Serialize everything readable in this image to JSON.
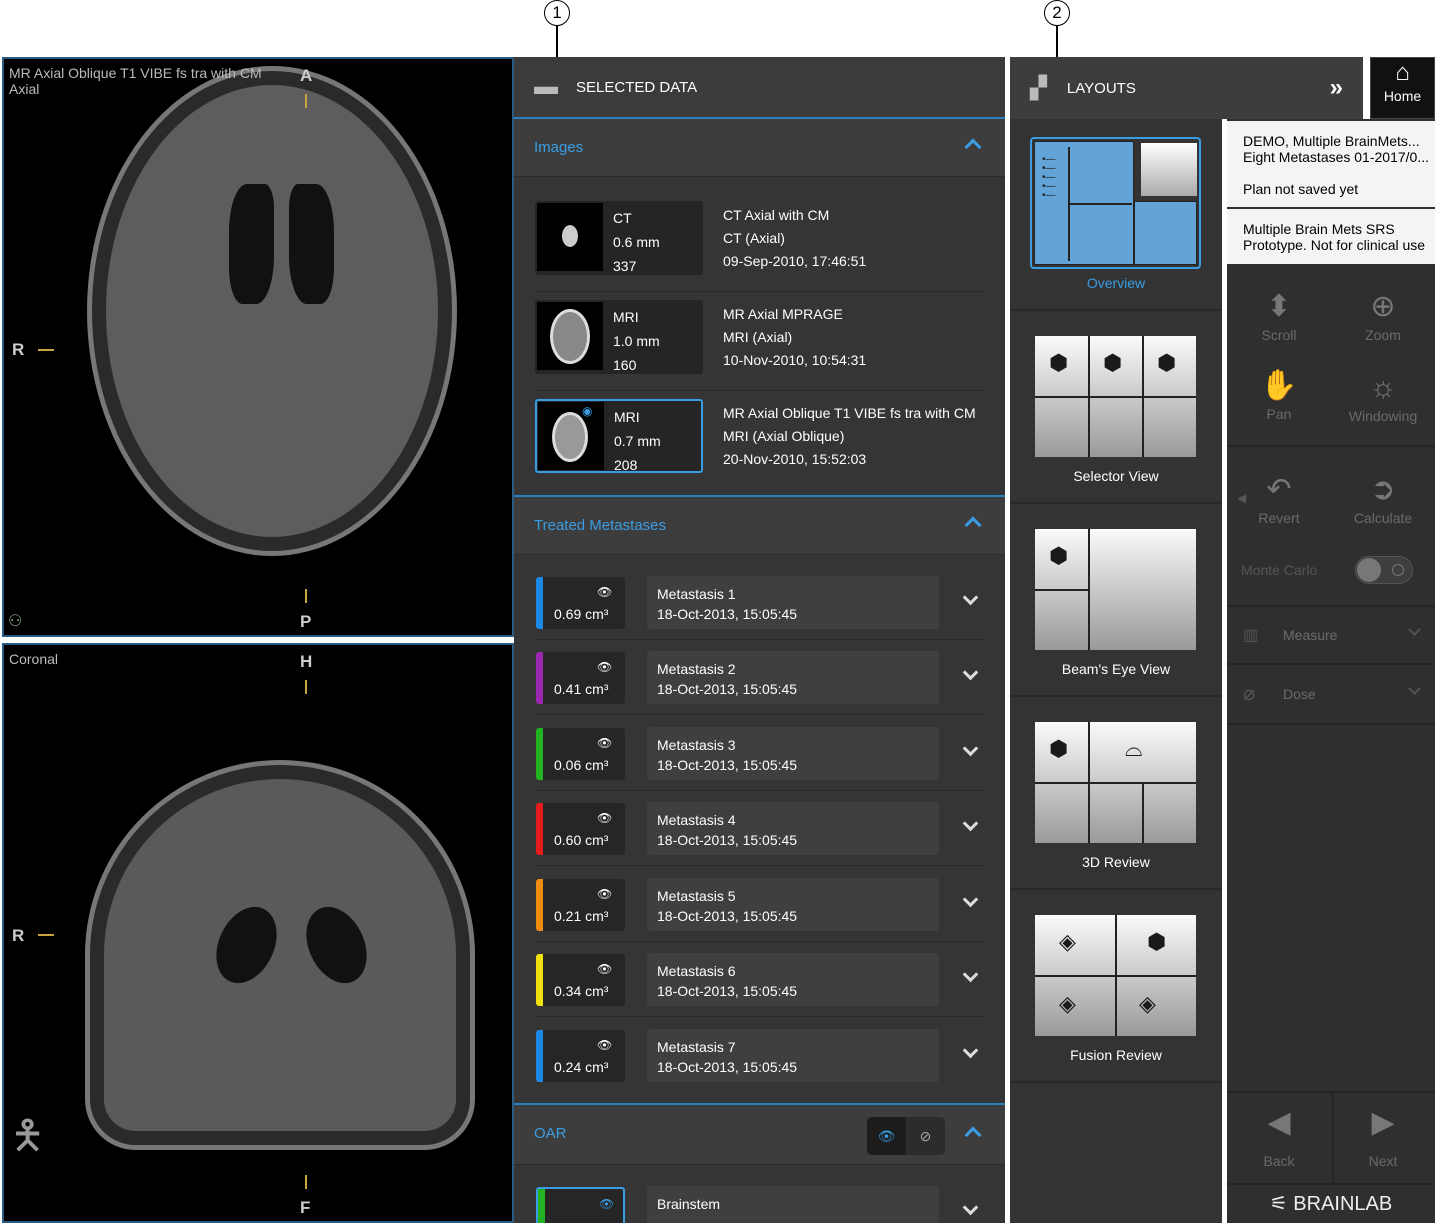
{
  "callouts": [
    "1",
    "2"
  ],
  "viewer_axial": {
    "title": "MR Axial Oblique T1 VIBE fs tra with CM\nAxial",
    "top": "A",
    "bottom": "P",
    "left": "R"
  },
  "viewer_coronal": {
    "title": "Coronal",
    "top": "H",
    "bottom": "F",
    "left": "R"
  },
  "selected_data": {
    "title": "SELECTED DATA",
    "images_title": "Images",
    "images": [
      {
        "modality": "CT",
        "thickness": "0.6 mm",
        "slices": "337",
        "name": "CT Axial with CM",
        "type": "CT (Axial)",
        "date": "09-Sep-2010, 17:46:51"
      },
      {
        "modality": "MRI",
        "thickness": "1.0 mm",
        "slices": "160",
        "name": "MR Axial MPRAGE",
        "type": "MRI (Axial)",
        "date": "10-Nov-2010, 10:54:31"
      },
      {
        "modality": "MRI",
        "thickness": "0.7 mm",
        "slices": "208",
        "name": "MR Axial Oblique T1 VIBE fs tra with CM",
        "type": "MRI (Axial Oblique)",
        "date": "20-Nov-2010, 15:52:03"
      }
    ],
    "metastases_title": "Treated Metastases",
    "metastases": [
      {
        "volume": "0.69 cm³",
        "name": "Metastasis 1",
        "date": "18-Oct-2013, 15:05:45",
        "color": "#1e88e5"
      },
      {
        "volume": "0.41 cm³",
        "name": "Metastasis 2",
        "date": "18-Oct-2013, 15:05:45",
        "color": "#9c27b0"
      },
      {
        "volume": "0.06 cm³",
        "name": "Metastasis 3",
        "date": "18-Oct-2013, 15:05:45",
        "color": "#22b222"
      },
      {
        "volume": "0.60 cm³",
        "name": "Metastasis 4",
        "date": "18-Oct-2013, 15:05:45",
        "color": "#e51c1c"
      },
      {
        "volume": "0.21 cm³",
        "name": "Metastasis 5",
        "date": "18-Oct-2013, 15:05:45",
        "color": "#f08c10"
      },
      {
        "volume": "0.34 cm³",
        "name": "Metastasis 6",
        "date": "18-Oct-2013, 15:05:45",
        "color": "#f0e010"
      },
      {
        "volume": "0.24 cm³",
        "name": "Metastasis 7",
        "date": "18-Oct-2013, 15:05:45",
        "color": "#1e88e5"
      }
    ],
    "oar_title": "OAR",
    "oar": [
      {
        "name": "Brainstem",
        "color": "#22b222"
      }
    ]
  },
  "layouts": {
    "title": "LAYOUTS",
    "items": [
      "Overview",
      "Selector View",
      "Beam's Eye View",
      "3D Review",
      "Fusion Review"
    ]
  },
  "home_label": "Home",
  "info": {
    "patient_line1": "DEMO, Multiple BrainMets...",
    "patient_line2": "Eight Metastases 01-2017/0...",
    "plan_status": "Plan not saved yet",
    "notice_line1": "Multiple Brain Mets SRS",
    "notice_line2": "Prototype. Not for clinical use"
  },
  "tools": {
    "scroll": "Scroll",
    "zoom": "Zoom",
    "pan": "Pan",
    "windowing": "Windowing",
    "revert": "Revert",
    "calculate": "Calculate",
    "monte_carlo": "Monte Carlo",
    "measure": "Measure",
    "dose": "Dose",
    "back": "Back",
    "next": "Next"
  },
  "brand": "BRAINLAB",
  "colors": {
    "accent": "#3a9de3",
    "panel": "#353535"
  }
}
